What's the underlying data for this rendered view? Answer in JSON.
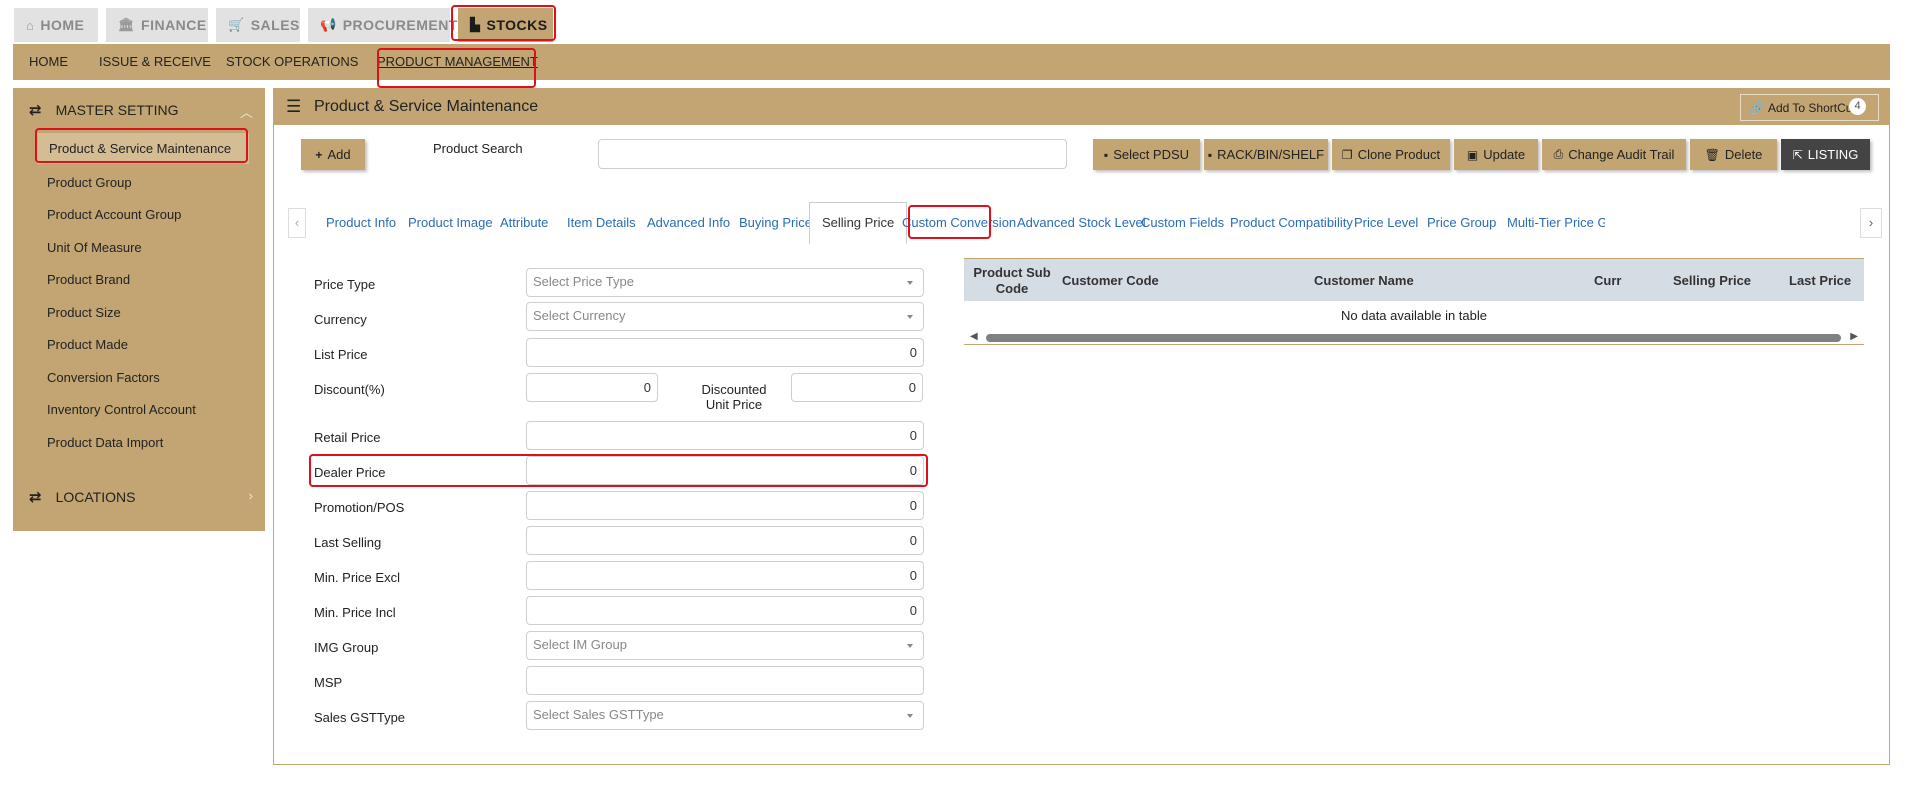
{
  "top_tabs": [
    {
      "label": "HOME",
      "icon": "home-icon"
    },
    {
      "label": "FINANCE",
      "icon": "bank-icon"
    },
    {
      "label": "SALES",
      "icon": "cart-icon"
    },
    {
      "label": "PROCUREMENT",
      "icon": "megaphone-icon"
    },
    {
      "label": "STOCKS",
      "icon": "factory-icon"
    }
  ],
  "sub_nav": [
    "HOME",
    "ISSUE & RECEIVE",
    "STOCK OPERATIONS",
    "PRODUCT MANAGEMENT"
  ],
  "sidebar": {
    "master_setting": "MASTER SETTING",
    "items": [
      "Product & Service Maintenance",
      "Product Group",
      "Product Account Group",
      "Unit Of Measure",
      "Product Brand",
      "Product Size",
      "Product Made",
      "Conversion Factors",
      "Inventory Control Account",
      "Product Data Import"
    ],
    "locations": "LOCATIONS"
  },
  "panel": {
    "title": "Product & Service Maintenance",
    "shortcut_label": "Add To ShortCut",
    "shortcut_count": "4"
  },
  "toolbar": {
    "add": "Add",
    "search_label": "Product Search",
    "select_pdsu": "Select PDSU",
    "rack": "RACK/BIN/SHELF",
    "clone": "Clone Product",
    "update": "Update",
    "audit": "Change Audit Trail",
    "delete": "Delete",
    "listing": "LISTING"
  },
  "tabs": [
    "Product Info",
    "Product Image",
    "Attribute",
    "Item Details",
    "Advanced Info",
    "Buying Price",
    "Selling Price",
    "Custom Conversion",
    "Advanced Stock Level",
    "Custom Fields",
    "Product Compatibility",
    "Price Level",
    "Price Group",
    "Multi-Tier Price G"
  ],
  "form": {
    "price_type": {
      "label": "Price Type",
      "placeholder": "Select Price Type"
    },
    "currency": {
      "label": "Currency",
      "placeholder": "Select Currency"
    },
    "list_price": {
      "label": "List Price",
      "value": "0"
    },
    "discount": {
      "label": "Discount(%)",
      "value": "0"
    },
    "discounted_unit_price": {
      "label_line1": "Discounted",
      "label_line2": "Unit Price",
      "value": "0"
    },
    "retail_price": {
      "label": "Retail Price",
      "value": "0"
    },
    "dealer_price": {
      "label": "Dealer Price",
      "value": "0"
    },
    "promotion_pos": {
      "label": "Promotion/POS",
      "value": "0"
    },
    "last_selling": {
      "label": "Last Selling",
      "value": "0"
    },
    "min_price_excl": {
      "label": "Min. Price Excl",
      "value": "0"
    },
    "min_price_incl": {
      "label": "Min. Price Incl",
      "value": "0"
    },
    "img_group": {
      "label": "IMG Group",
      "placeholder": "Select IM Group"
    },
    "msp": {
      "label": "MSP",
      "value": ""
    },
    "sales_gst_type": {
      "label": "Sales GSTType",
      "placeholder": "Select Sales GSTType"
    }
  },
  "table": {
    "headers": {
      "product_sub_code_1": "Product Sub",
      "product_sub_code_2": "Code",
      "customer_code": "Customer Code",
      "customer_name": "Customer Name",
      "curr": "Curr",
      "selling_price": "Selling Price",
      "last_price": "Last Price"
    },
    "empty_message": "No data available in table"
  },
  "colors": {
    "accent": "#c2a572",
    "highlight": "#e0101a",
    "link": "#2a6db3"
  }
}
